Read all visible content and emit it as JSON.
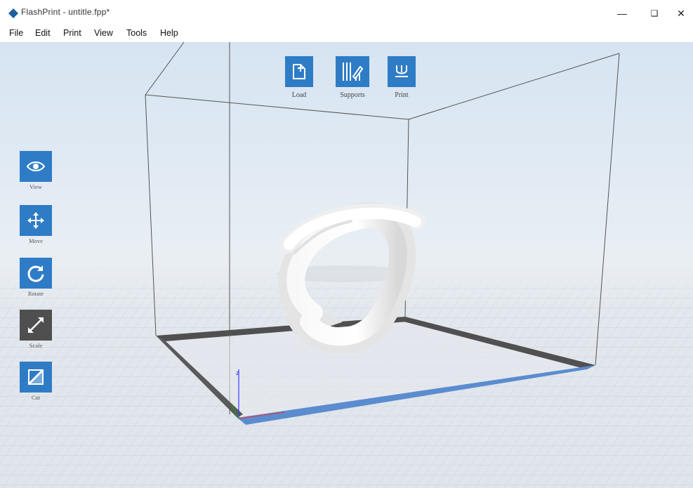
{
  "window": {
    "title": "FlashPrint - untitle.fpp*",
    "controls": {
      "minimize": "—",
      "maximize": "❑",
      "close": "✕"
    }
  },
  "menu": [
    "File",
    "Edit",
    "Print",
    "View",
    "Tools",
    "Help"
  ],
  "top_toolbar": [
    {
      "label": "Load",
      "icon": "load-icon"
    },
    {
      "label": "Supports",
      "icon": "supports-icon"
    },
    {
      "label": "Print",
      "icon": "print-icon"
    }
  ],
  "side_toolbar": [
    {
      "label": "View",
      "icon": "eye-icon"
    },
    {
      "label": "Move",
      "icon": "move-arrows-icon"
    },
    {
      "label": "Rotate",
      "icon": "rotate-icon"
    },
    {
      "label": "Scale",
      "icon": "scale-icon",
      "active": true
    },
    {
      "label": "Cut",
      "icon": "cut-icon"
    }
  ],
  "axis": {
    "z_label": "z"
  },
  "colors": {
    "accent": "#2f7cc6",
    "active_tool": "#4f4f4f",
    "build_plate_front_edge": "#5b8ccf",
    "grid_floor": "#dfe5ec",
    "sky_top": "#d7e5f2"
  }
}
